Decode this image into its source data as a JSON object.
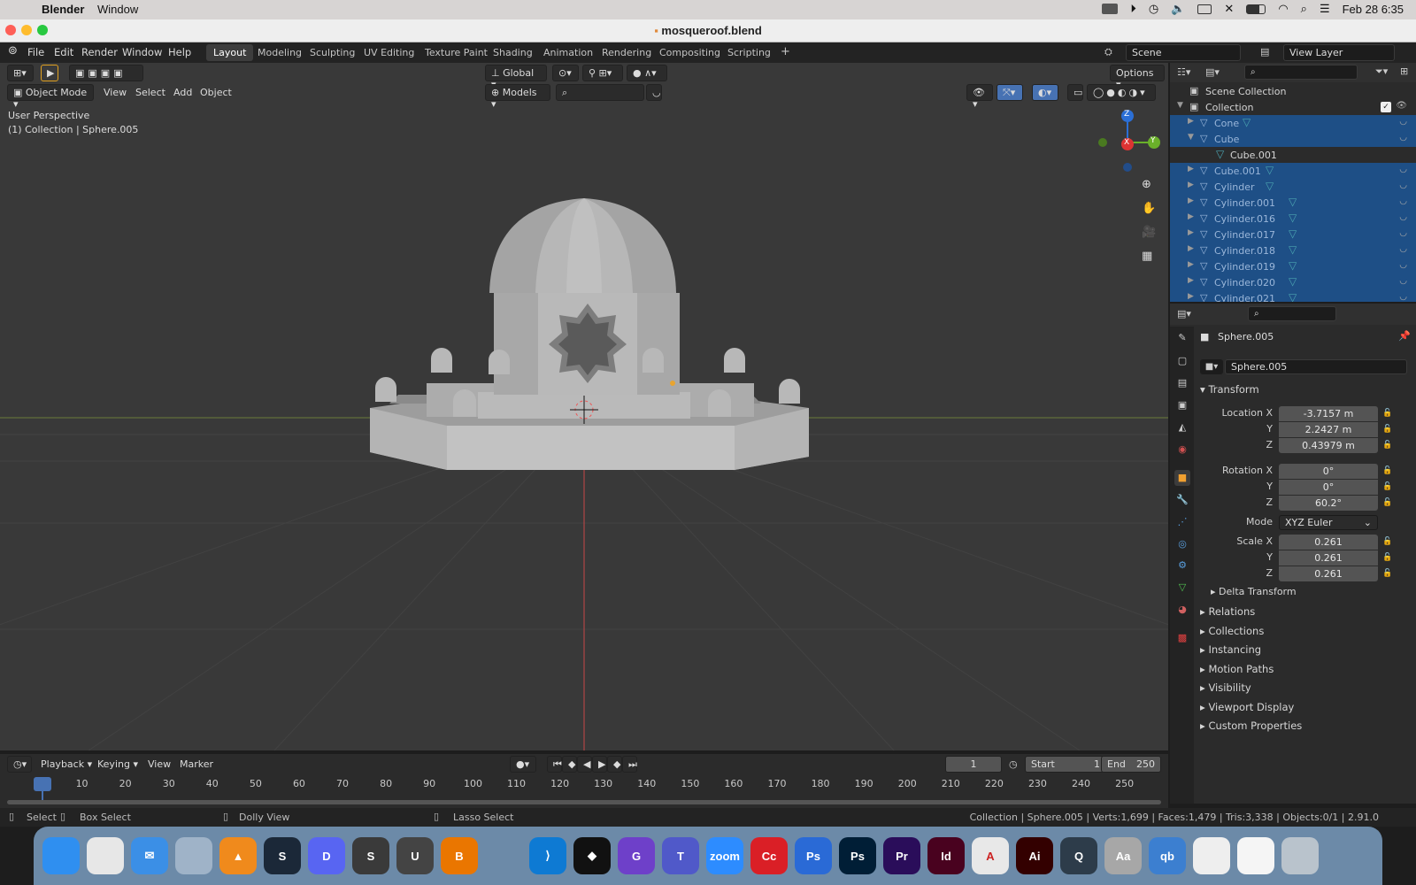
{
  "menubar": {
    "app": "Blender",
    "window": "Window",
    "clock": "Feb 28  6:35"
  },
  "window_title": "mosqueroof.blend",
  "topbar": {
    "menus": [
      "File",
      "Edit",
      "Render",
      "Window",
      "Help"
    ],
    "workspaces": [
      "Layout",
      "Modeling",
      "Sculpting",
      "UV Editing",
      "Texture Paint",
      "Shading",
      "Animation",
      "Rendering",
      "Compositing",
      "Scripting"
    ],
    "active_workspace": "Layout",
    "scene": "Scene",
    "view_layer": "View Layer"
  },
  "viewport": {
    "orientation": "Global",
    "options": "Options",
    "mode": "Object Mode",
    "menus": [
      "View",
      "Select",
      "Add",
      "Object"
    ],
    "models": "Models",
    "perspective": "User Perspective",
    "context": "(1) Collection | Sphere.005",
    "gizmo": {
      "x": "X",
      "y": "Y",
      "z": "Z"
    }
  },
  "outliner": {
    "root": "Scene Collection",
    "collection": "Collection",
    "items": [
      {
        "name": "Cone",
        "selected": true
      },
      {
        "name": "Cube",
        "selected": true,
        "expanded": true
      },
      {
        "name": "Cube.001",
        "selected": false,
        "child": true
      },
      {
        "name": "Cube.001",
        "selected": true
      },
      {
        "name": "Cylinder",
        "selected": true
      },
      {
        "name": "Cylinder.001",
        "selected": true
      },
      {
        "name": "Cylinder.016",
        "selected": true
      },
      {
        "name": "Cylinder.017",
        "selected": true
      },
      {
        "name": "Cylinder.018",
        "selected": true
      },
      {
        "name": "Cylinder.019",
        "selected": true
      },
      {
        "name": "Cylinder.020",
        "selected": true
      },
      {
        "name": "Cylinder.021",
        "selected": true
      }
    ]
  },
  "properties": {
    "object_name": "Sphere.005",
    "data_name": "Sphere.005",
    "transform_label": "Transform",
    "location_label": "Location X",
    "rotation_label": "Rotation X",
    "scale_label": "Scale X",
    "y_label": "Y",
    "z_label": "Z",
    "location": [
      "-3.7157 m",
      "2.2427 m",
      "0.43979 m"
    ],
    "rotation": [
      "0°",
      "0°",
      "60.2°"
    ],
    "mode_label": "Mode",
    "mode": "XYZ Euler",
    "scale": [
      "0.261",
      "0.261",
      "0.261"
    ],
    "delta": "Delta Transform",
    "panels": [
      "Relations",
      "Collections",
      "Instancing",
      "Motion Paths",
      "Visibility",
      "Viewport Display",
      "Custom Properties"
    ]
  },
  "timeline": {
    "menus": [
      "Playback",
      "Keying",
      "View",
      "Marker"
    ],
    "current": "1",
    "start_label": "Start",
    "start": "1",
    "end_label": "End",
    "end": "250",
    "ticks": [
      "1",
      "10",
      "20",
      "30",
      "40",
      "50",
      "60",
      "70",
      "80",
      "90",
      "100",
      "110",
      "120",
      "130",
      "140",
      "150",
      "160",
      "170",
      "180",
      "190",
      "200",
      "210",
      "220",
      "230",
      "240",
      "250"
    ]
  },
  "status": {
    "select": "Select",
    "box_select": "Box Select",
    "dolly": "Dolly View",
    "lasso": "Lasso Select",
    "info": "Collection | Sphere.005 | Verts:1,699 | Faces:1,479 | Tris:3,338 | Objects:0/1 | 2.91.0"
  },
  "dock": [
    {
      "name": "finder",
      "label": "",
      "color": "#2f8ff0"
    },
    {
      "name": "launchpad",
      "label": "",
      "color": "#e7e7e7"
    },
    {
      "name": "mail",
      "label": "✉",
      "color": "#3b8fe6"
    },
    {
      "name": "preview",
      "label": "",
      "color": "#9fb3c8"
    },
    {
      "name": "vlc",
      "label": "▲",
      "color": "#f08a1c"
    },
    {
      "name": "steam",
      "label": "S",
      "color": "#1b2838"
    },
    {
      "name": "discord",
      "label": "D",
      "color": "#5865f2"
    },
    {
      "name": "sublime",
      "label": "S",
      "color": "#3a3a3a"
    },
    {
      "name": "unity",
      "label": "U",
      "color": "#444"
    },
    {
      "name": "blender",
      "label": "B",
      "color": "#ea7600"
    },
    {
      "name": "cursor",
      "label": "",
      "color": "#6c8aa8"
    },
    {
      "name": "vscode",
      "label": "⟩",
      "color": "#0e7ad3"
    },
    {
      "name": "unity-hub",
      "label": "◆",
      "color": "#111"
    },
    {
      "name": "github",
      "label": "G",
      "color": "#6e40c9"
    },
    {
      "name": "teams",
      "label": "T",
      "color": "#5059c9"
    },
    {
      "name": "zoom",
      "label": "zoom",
      "color": "#2d8cff"
    },
    {
      "name": "creative-cloud",
      "label": "Cc",
      "color": "#da1f26"
    },
    {
      "name": "photoshop-beta",
      "label": "Ps",
      "color": "#2a6ad6"
    },
    {
      "name": "photoshop",
      "label": "Ps",
      "color": "#001e36"
    },
    {
      "name": "premiere",
      "label": "Pr",
      "color": "#2a0d5a"
    },
    {
      "name": "indesign",
      "label": "Id",
      "color": "#49021f"
    },
    {
      "name": "acrobat",
      "label": "A",
      "color": "#e8e8e8"
    },
    {
      "name": "illustrator",
      "label": "Ai",
      "color": "#330000"
    },
    {
      "name": "quicktime",
      "label": "Q",
      "color": "#2d3c4a"
    },
    {
      "name": "font-book",
      "label": "Aa",
      "color": "#a7a7a7"
    },
    {
      "name": "qbittorrent",
      "label": "qb",
      "color": "#3c7fd0"
    },
    {
      "name": "chrome",
      "label": "",
      "color": "#eeeeee"
    },
    {
      "name": "document",
      "label": "",
      "color": "#f5f5f5"
    },
    {
      "name": "trash",
      "label": "",
      "color": "#b9c3cc"
    }
  ]
}
